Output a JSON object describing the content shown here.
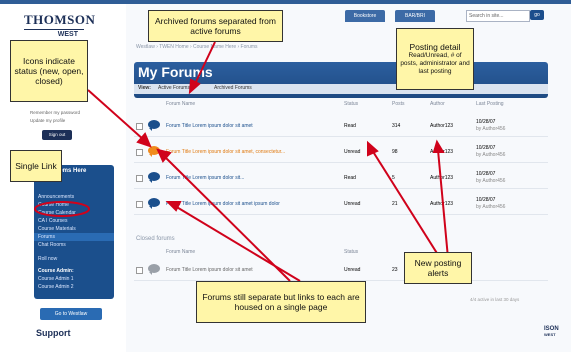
{
  "site": {
    "brand_top": "THOMSON",
    "brand_bottom": "WEST",
    "brand_small_top": "ISON",
    "brand_small_bottom": "WEST"
  },
  "header": {
    "tabs": [
      "Bookstore",
      "BAR/BRI"
    ],
    "search_placeholder": "Search in site...",
    "go_label": "go"
  },
  "breadcrumb": "Westlaw › TWEN Home › Course Name Here › Forums",
  "page": {
    "title": "My Forums",
    "view_label": "View:",
    "view_active": "Active Forums",
    "view_archived": "Archived Forums",
    "columns": [
      "Forum Name",
      "Status",
      "Posts",
      "Author",
      "Last Posting"
    ],
    "active_rows": [
      {
        "name": "Forum Title Lorem ipsum dolor sit amet",
        "status": "Read",
        "posts": "314",
        "author": "Author123",
        "last": "10/28/07",
        "by": "by Author456",
        "icon": "blue-bubble"
      },
      {
        "name": "Forum Title Lorem ipsum dolor sit amet, consectetur...",
        "status": "Unread",
        "posts": "98",
        "author": "Author123",
        "last": "10/28/07",
        "by": "by Author456",
        "icon": "orange-bubble"
      },
      {
        "name": "Forum Title Lorem ipsum dolor sit...",
        "status": "Read",
        "posts": "5",
        "author": "Author123",
        "last": "10/28/07",
        "by": "by Author456",
        "icon": "blue-bubble"
      },
      {
        "name": "Forum Title Lorem ipsum dolor sit amet ipsum dolor",
        "status": "Unread",
        "posts": "21",
        "author": "Author123",
        "last": "10/28/07",
        "by": "by Author456",
        "icon": "blue-bubble"
      }
    ],
    "closed_label": "Closed forums",
    "closed_rows": [
      {
        "name": "Forum Title Lorem ipsum dolor sit amet",
        "status": "Unread",
        "posts": "23",
        "author": "",
        "last": "",
        "by": "",
        "icon": "gray-bubble"
      }
    ],
    "footer": "4/4 active in last 30 days"
  },
  "sidebar": {
    "remember": "Remember my password",
    "update": "Update my profile",
    "signin": "Sign out",
    "panel_header": "Class Items Here",
    "nav": [
      "Announcements",
      "Course Home",
      "Course Calendar",
      "CA I Courses",
      "Course Materials",
      "Forums",
      "Chat Rooms"
    ],
    "roll_label": "Roll now",
    "admin_label": "Course Admin:",
    "admins": [
      "Course Admin 1",
      "Course Admin 2"
    ],
    "go_westlaw": "Go to Westlaw",
    "support": "Support"
  },
  "callouts": {
    "archived": "Archived forums separated from active forums",
    "posting_title": "Posting detail",
    "posting_body": "Read/Unread, # of posts, administrator and last posting",
    "icons": "Icons indicate status (new, open, closed)",
    "single_link": "Single Link",
    "new_alerts": "New posting alerts",
    "forums_links": "Forums still separate but links to each are housed on a single page"
  }
}
